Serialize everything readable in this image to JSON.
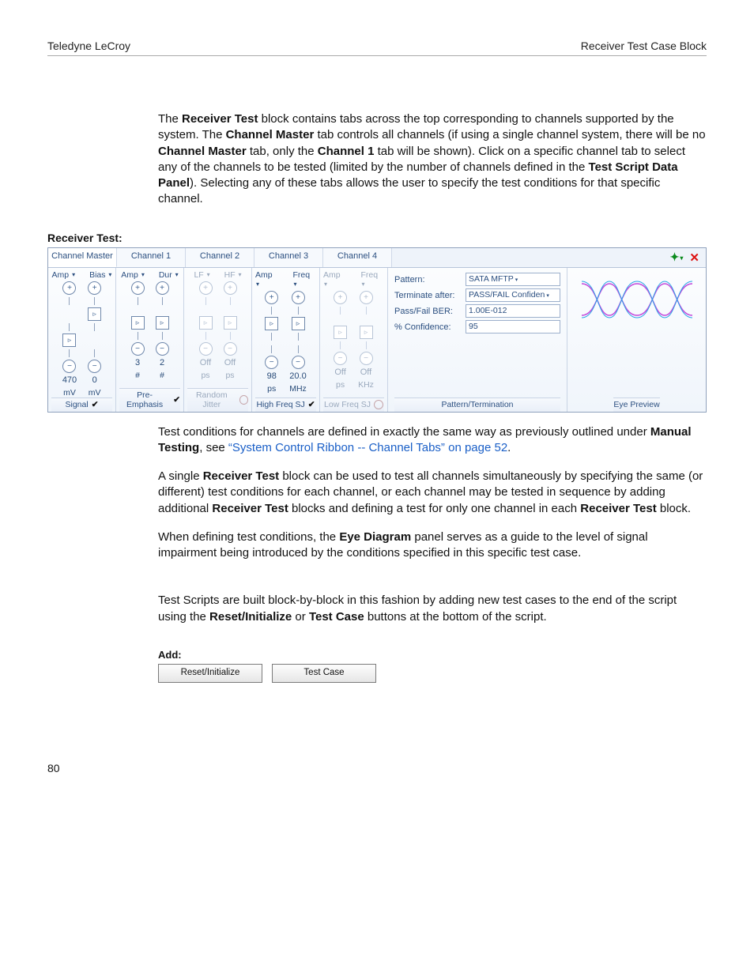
{
  "header": {
    "left": "Teledyne LeCroy",
    "right": "Receiver Test Case Block"
  },
  "para1_parts": [
    "The ",
    "**Receiver Test**",
    " block contains tabs across the top corresponding to channels supported by the system. The ",
    "**Channel Master**",
    " tab controls all channels (if using a single channel system, there will be no ",
    "**Channel Master**",
    " tab, only the ",
    "**Channel 1**",
    " tab will be shown). Click on a specific channel tab to select any of the channels to be tested (limited by the number of channels defined in the ",
    "**Test Script Data Panel**",
    ").   Selecting any of these tabs allows the user to specify the test conditions for that specific channel."
  ],
  "section_label": "Receiver Test:",
  "tabs": [
    "Channel Master",
    "Channel 1",
    "Channel 2",
    "Channel 3",
    "Channel 4"
  ],
  "active_tab_index": 0,
  "groups": [
    {
      "id": "signal",
      "dim": false,
      "head": [
        "Amp",
        "Bias"
      ],
      "val": [
        "470",
        "0"
      ],
      "unit": [
        "mV",
        "mV"
      ],
      "footer": "Signal",
      "mark": "check",
      "play_mode": "top"
    },
    {
      "id": "preemphasis",
      "dim": false,
      "head": [
        "Amp",
        "Dur"
      ],
      "val": [
        "3",
        "2"
      ],
      "unit": [
        "#",
        "#"
      ],
      "footer": "Pre-Emphasis",
      "mark": "check",
      "play_mode": "both"
    },
    {
      "id": "randomjitter",
      "dim": true,
      "head": [
        "LF",
        "HF"
      ],
      "val": [
        "Off",
        "Off"
      ],
      "unit": [
        "ps",
        "ps"
      ],
      "footer": "Random Jitter",
      "mark": "ring",
      "play_mode": "both"
    },
    {
      "id": "highfreqsj",
      "dim": false,
      "head": [
        "Amp",
        "Freq"
      ],
      "val": [
        "98",
        "20.0"
      ],
      "unit": [
        "ps",
        "MHz"
      ],
      "footer": "High Freq SJ",
      "mark": "check",
      "play_mode": "top2"
    },
    {
      "id": "lowfreqsj",
      "dim": true,
      "head": [
        "Amp",
        "Freq"
      ],
      "val": [
        "Off",
        "Off"
      ],
      "unit": [
        "ps",
        "KHz"
      ],
      "footer": "Low Freq SJ",
      "mark": "ring",
      "play_mode": "both"
    }
  ],
  "pattern": {
    "label_pattern": "Pattern:",
    "val_pattern": "SATA MFTP",
    "label_term": "Terminate after:",
    "val_term": "PASS/FAIL Confiden",
    "label_ber": "Pass/Fail BER:",
    "val_ber": "1.00E-012",
    "label_conf": "% Confidence:",
    "val_conf": "95",
    "footer": "Pattern/Termination"
  },
  "eye": {
    "footer": "Eye Preview"
  },
  "para2_pre": "Test conditions for channels are defined in exactly the same way as previously outlined under ",
  "para2_bold": "Manual Testing",
  "para2_mid": ", see ",
  "para2_link": "“System Control Ribbon -- Channel Tabs” on page 52",
  "para2_post": ".",
  "para3_parts": [
    "A single ",
    "**Receiver Test**",
    " block can be used to test all channels simultaneously by specifying the same (or different) test conditions for each channel, or each channel may be tested in sequence by adding additional ",
    "**Receiver Test**",
    " blocks and defining a test for only one channel in each ",
    "**Receiver Test**",
    " block."
  ],
  "para4_parts": [
    "When defining test conditions, the ",
    "**Eye Diagram**",
    " panel serves as a guide to the level of signal impairment being introduced by the conditions specified in this specific test case."
  ],
  "para5_parts": [
    "Test Scripts are built block-by-block in this fashion by adding new test cases to the end of the script using the ",
    "**Reset/Initialize**",
    " or ",
    "**Test Case**",
    " buttons at the bottom of the script."
  ],
  "add": {
    "label": "Add:",
    "btn1": "Reset/Initialize",
    "btn2": "Test Case"
  },
  "page_number": "80"
}
